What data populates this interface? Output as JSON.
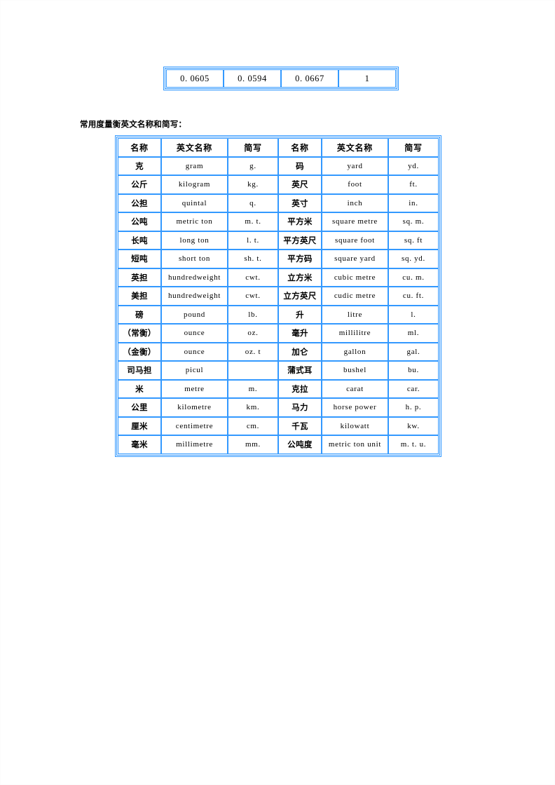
{
  "document": {
    "heading": "常用度量衡英文名称和简写："
  },
  "conversion_strip": {
    "values": [
      "0. 0605",
      "0. 0594",
      "0. 0667",
      "1"
    ]
  },
  "units_table": {
    "headers": [
      "名称",
      "英文名称",
      "简写",
      "名称",
      "英文名称",
      "简写"
    ],
    "rows": [
      {
        "cn_l": "克",
        "en_l": "gram",
        "ab_l": "g.",
        "cn_r": "码",
        "en_r": "yard",
        "ab_r": "yd."
      },
      {
        "cn_l": "公斤",
        "en_l": "kilogram",
        "ab_l": "kg.",
        "cn_r": "英尺",
        "en_r": "foot",
        "ab_r": "ft."
      },
      {
        "cn_l": "公担",
        "en_l": "quintal",
        "ab_l": "q.",
        "cn_r": "英寸",
        "en_r": "inch",
        "ab_r": "in."
      },
      {
        "cn_l": "公吨",
        "en_l": "metric ton",
        "ab_l": "m. t.",
        "cn_r": "平方米",
        "en_r": "square metre",
        "ab_r": "sq. m."
      },
      {
        "cn_l": "长吨",
        "en_l": "long ton",
        "ab_l": "l. t.",
        "cn_r": "平方英尺",
        "en_r": "square foot",
        "ab_r": "sq. ft"
      },
      {
        "cn_l": "短吨",
        "en_l": "short ton",
        "ab_l": "sh. t.",
        "cn_r": "平方码",
        "en_r": "square yard",
        "ab_r": "sq. yd."
      },
      {
        "cn_l": "英担",
        "en_l": "hundredweight",
        "ab_l": "cwt.",
        "cn_r": "立方米",
        "en_r": "cubic metre",
        "ab_r": "cu. m."
      },
      {
        "cn_l": "美担",
        "en_l": "hundredweight",
        "ab_l": "cwt.",
        "cn_r": "立方英尺",
        "en_r": "cudic metre",
        "ab_r": "cu. ft."
      },
      {
        "cn_l": "磅",
        "en_l": "pound",
        "ab_l": "lb.",
        "cn_r": "升",
        "en_r": "litre",
        "ab_r": "l."
      },
      {
        "cn_l": "（常衡）",
        "en_l": "ounce",
        "ab_l": "oz.",
        "cn_r": "毫升",
        "en_r": "millilitre",
        "ab_r": "ml."
      },
      {
        "cn_l": "（金衡）",
        "en_l": "ounce",
        "ab_l": "oz. t",
        "cn_r": "加仑",
        "en_r": "gallon",
        "ab_r": "gal."
      },
      {
        "cn_l": "司马担",
        "en_l": "picul",
        "ab_l": "",
        "cn_r": "蒲式耳",
        "en_r": "bushel",
        "ab_r": "bu."
      },
      {
        "cn_l": "米",
        "en_l": "metre",
        "ab_l": "m.",
        "cn_r": "克拉",
        "en_r": "carat",
        "ab_r": "car."
      },
      {
        "cn_l": "公里",
        "en_l": "kilometre",
        "ab_l": "km.",
        "cn_r": "马力",
        "en_r": "horse power",
        "ab_r": "h. p."
      },
      {
        "cn_l": "厘米",
        "en_l": "centimetre",
        "ab_l": "cm.",
        "cn_r": "千瓦",
        "en_r": "kilowatt",
        "ab_r": "kw."
      },
      {
        "cn_l": "毫米",
        "en_l": "millimetre",
        "ab_l": "mm.",
        "cn_r": "公吨度",
        "en_r": "metric ton unit",
        "ab_r": "m. t. u."
      }
    ]
  },
  "colors": {
    "border": "#3399ff",
    "text": "#000000",
    "background": "#ffffff"
  }
}
